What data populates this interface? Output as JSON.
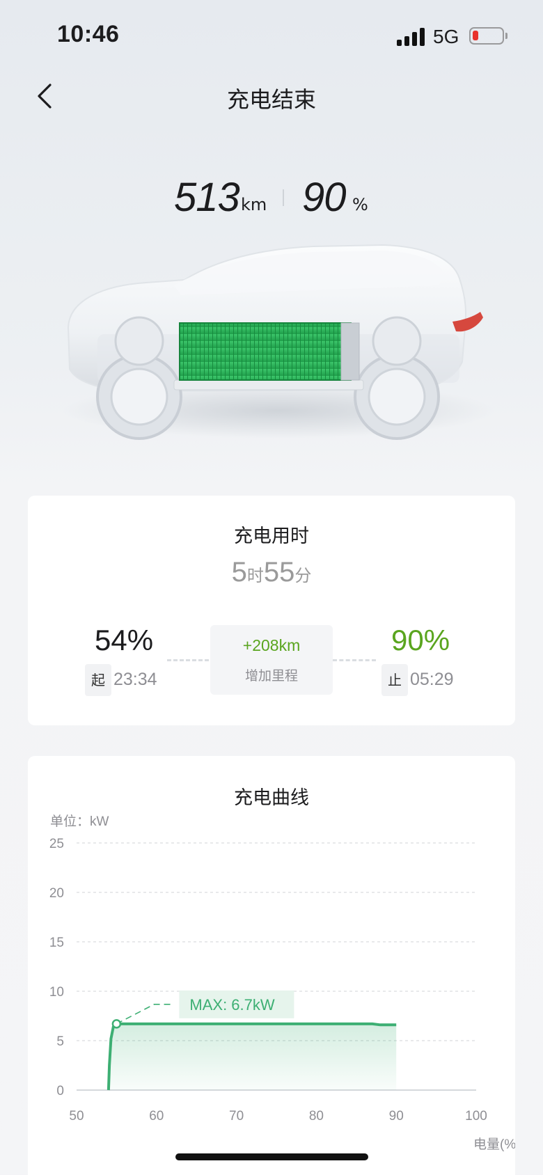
{
  "status": {
    "time": "10:46",
    "network": "5G",
    "battery_level": 0.12,
    "battery_color": "#e8322c"
  },
  "header": {
    "title": "充电结束",
    "back_icon": "chevron-left-icon"
  },
  "stats": {
    "range_value": "513",
    "range_unit": "km",
    "soc_value": "90",
    "soc_unit": "%"
  },
  "charging_time": {
    "title": "充电用时",
    "hours": "5",
    "hours_unit": "时",
    "minutes": "55",
    "minutes_unit": "分",
    "start_pct": "54%",
    "start_tag": "起",
    "start_time": "23:34",
    "end_pct": "90%",
    "end_tag": "止",
    "end_time": "05:29",
    "gain_value": "+208km",
    "gain_label": "增加里程"
  },
  "charging_curve": {
    "title": "充电曲线",
    "unit_label": "单位：kW",
    "max_label": "MAX: 6.7kW",
    "x_unit": "电量(%)"
  },
  "colors": {
    "accent_green": "#5aa51f",
    "curve_green": "#3daf73"
  },
  "chart_data": {
    "type": "area",
    "ylabel": "单位：kW",
    "xlabel": "电量(%)",
    "xlim": [
      50,
      100
    ],
    "ylim": [
      0,
      25
    ],
    "x_ticks": [
      "50",
      "60",
      "70",
      "80",
      "90",
      "100"
    ],
    "y_ticks": [
      "25",
      "20",
      "15",
      "10",
      "5",
      "0"
    ],
    "grid": true,
    "annotation": "MAX: 6.7kW",
    "max_point": {
      "x": 55,
      "y": 6.7
    },
    "series": [
      {
        "x": [
          54,
          54.1,
          54.3,
          54.6,
          55,
          56,
          60,
          70,
          80,
          87,
          88,
          89,
          90
        ],
        "y": [
          0,
          2.5,
          5.2,
          6.4,
          6.7,
          6.7,
          6.7,
          6.7,
          6.7,
          6.7,
          6.6,
          6.6,
          6.6
        ]
      }
    ]
  }
}
